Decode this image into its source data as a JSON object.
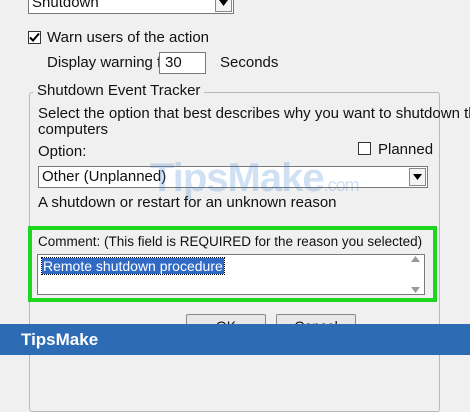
{
  "shutdown_combo": {
    "value": "Shutdown"
  },
  "warn_users": {
    "label": "Warn users of the action",
    "checked": true
  },
  "warning": {
    "label": "Display warning for",
    "value": "30",
    "unit": "Seconds"
  },
  "tracker": {
    "title": "Shutdown Event Tracker",
    "instructions_line1": "Select the option that best describes why you want to shutdown the",
    "instructions_line2": "computers",
    "option_label": "Option:",
    "planned_label": "Planned",
    "planned_checked": false,
    "option_value": "Other (Unplanned)",
    "description": "A shutdown or restart for an unknown reason",
    "comment_label": "Comment: (This field is REQUIRED for the reason you selected)",
    "comment_value": "Remote shutdown procedure"
  },
  "buttons": {
    "ok": "OK",
    "cancel": "Cancel"
  },
  "watermark": {
    "main": "TipsMake",
    "suffix": ".com"
  },
  "footer": {
    "brand": "TipsMake"
  },
  "colors": {
    "highlight": "#1ed61e",
    "footer": "#2d6bb5",
    "selection": "#316ac5"
  }
}
